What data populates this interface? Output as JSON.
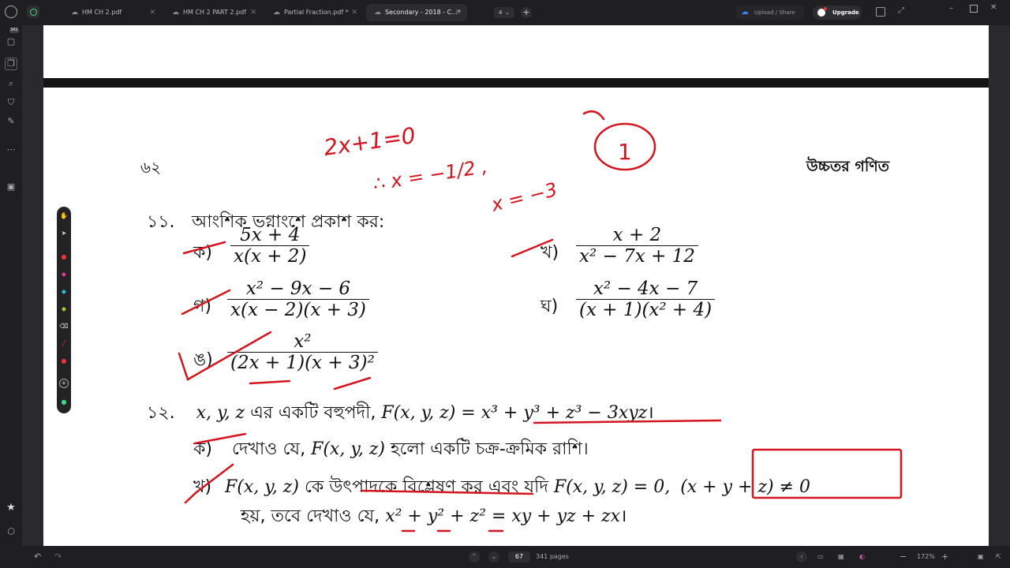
{
  "tabs": [
    {
      "label": "HM CH 2.pdf",
      "active": false
    },
    {
      "label": "HM CH 2 PART 2.pdf",
      "active": false
    },
    {
      "label": "Partial Fraction.pdf *",
      "active": false
    },
    {
      "label": "Secondary - 2018 - C...*",
      "active": true
    }
  ],
  "topbar": {
    "tab_count": "4",
    "upload_label": "Upload / Share",
    "upgrade_label": "Upgrade"
  },
  "sidebar": {
    "pages_badge": "341"
  },
  "page": {
    "page_number": "৬২",
    "header_right": "উচ্চতর গণিত",
    "q11": {
      "number": "১১.",
      "title": "আংশিক ভগ্নাংশে প্রকাশ কর:",
      "items": [
        {
          "label": "ক)",
          "num": "5x + 4",
          "den": "x(x + 2)"
        },
        {
          "label": "খ)",
          "num": "x + 2",
          "den": "x² − 7x + 12"
        },
        {
          "label": "গ)",
          "num": "x² − 9x − 6",
          "den": "x(x − 2)(x + 3)"
        },
        {
          "label": "ঘ)",
          "num": "x² − 4x − 7",
          "den": "(x + 1)(x² + 4)"
        },
        {
          "label": "ঙ)",
          "num": "x²",
          "den": "(2x + 1)(x + 3)²"
        }
      ]
    },
    "q12": {
      "number": "১২.",
      "line1_vars": "x, y, z",
      "line1_text": "এর একটি বহুপদী,",
      "line1_math": "F(x, y, z) = x³ + y³ + z³ − 3xyz",
      "line1_end": "।",
      "a_label": "ক)",
      "a_text1": "দেখাও যে,",
      "a_math": "F(x, y, z)",
      "a_text2": "হলো একটি চক্র-ক্রমিক রাশি।",
      "b_label": "খ)",
      "b_math1": "F(x, y, z)",
      "b_text1": "কে উৎপাদকে বিশ্লেষণ কর এবং যদি",
      "b_math2": "F(x, y, z) = 0,",
      "b_math3": "(x + y + z) ≠ 0",
      "b_text2": "হয়, তবে দেখাও যে,",
      "b_math4": "x² + y² + z² = xy + yz + zx",
      "b_end": "।"
    }
  },
  "annotations": {
    "eq1": "2x+1=0",
    "eq2": "∴ x = −1/2 ,",
    "eq3": "x = −3",
    "circled": "1"
  },
  "bottombar": {
    "current_page": "67",
    "total_pages": "341 pages",
    "zoom": "172%"
  },
  "colors": {
    "ink": "#d4141f",
    "upgrade_bg": "#ffffff",
    "upload_icon": "#3b82f6",
    "background": "#1c1c1e"
  }
}
